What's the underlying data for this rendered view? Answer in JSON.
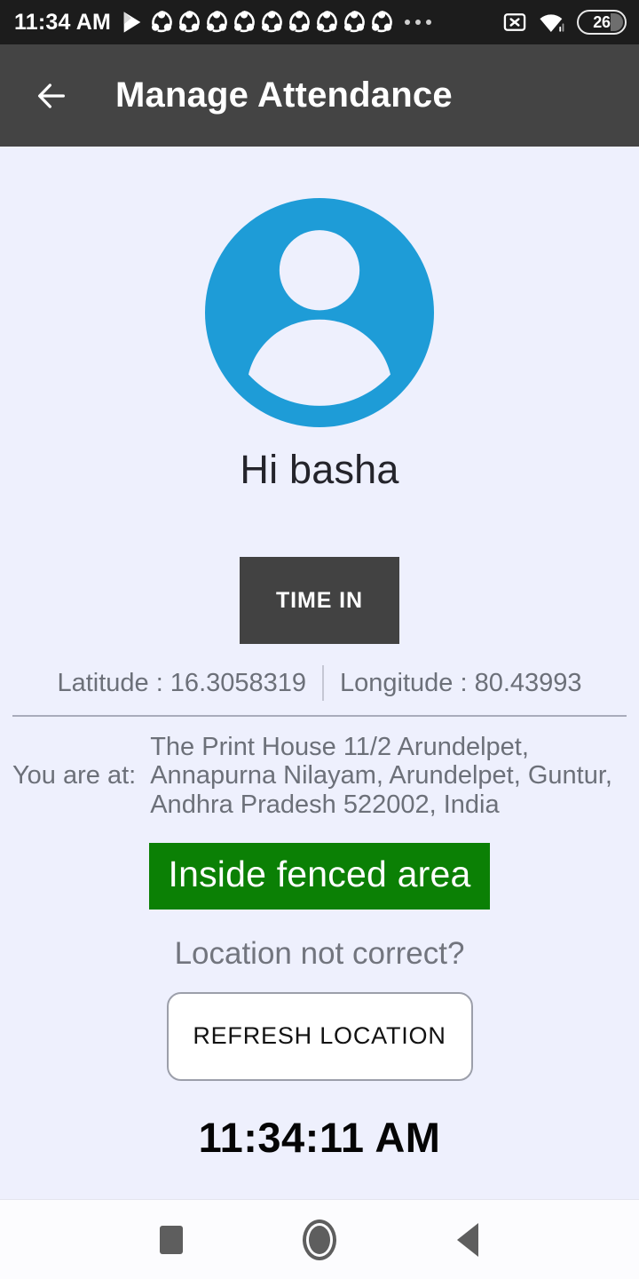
{
  "status_bar": {
    "clock": "11:34 AM",
    "icons": [
      "play-icon",
      "share-icon",
      "share-icon",
      "share-icon",
      "share-icon",
      "share-icon",
      "share-icon",
      "share-icon",
      "share-icon",
      "share-icon"
    ],
    "overflow": "more-notifications-icon",
    "no_sim_icon": "no-sim-icon",
    "wifi_icon": "wifi-icon",
    "battery_level": "26"
  },
  "app_bar": {
    "back_icon": "back-arrow-icon",
    "title": "Manage Attendance"
  },
  "profile": {
    "avatar_icon": "user-avatar-icon",
    "avatar_color": "#1E9CD7",
    "greeting": "Hi basha"
  },
  "actions": {
    "time_in_label": "TIME IN",
    "time_in_color": "#424242",
    "refresh_label": "REFRESH LOCATION"
  },
  "location": {
    "latitude_label": "Latitude",
    "latitude_value": "16.3058319",
    "latitude_text": "Latitude  : 16.3058319",
    "longitude_label": "Longitude",
    "longitude_value": "80.43993",
    "longitude_text": "Longitude  : 80.43993",
    "address_label": "You are at:",
    "address_value": "The Print House 11/2 Arundelpet, Annapurna Nilayam, Arundelpet, Guntur, Andhra Pradesh 522002, India",
    "fence_status": "Inside fenced area",
    "fence_color": "#0B8005",
    "prompt": "Location not correct?"
  },
  "clock": {
    "current_time": "11:34:11 AM"
  },
  "nav_bar": {
    "recents": "recents-square-icon",
    "home": "home-circle-icon",
    "back": "back-triangle-icon"
  }
}
